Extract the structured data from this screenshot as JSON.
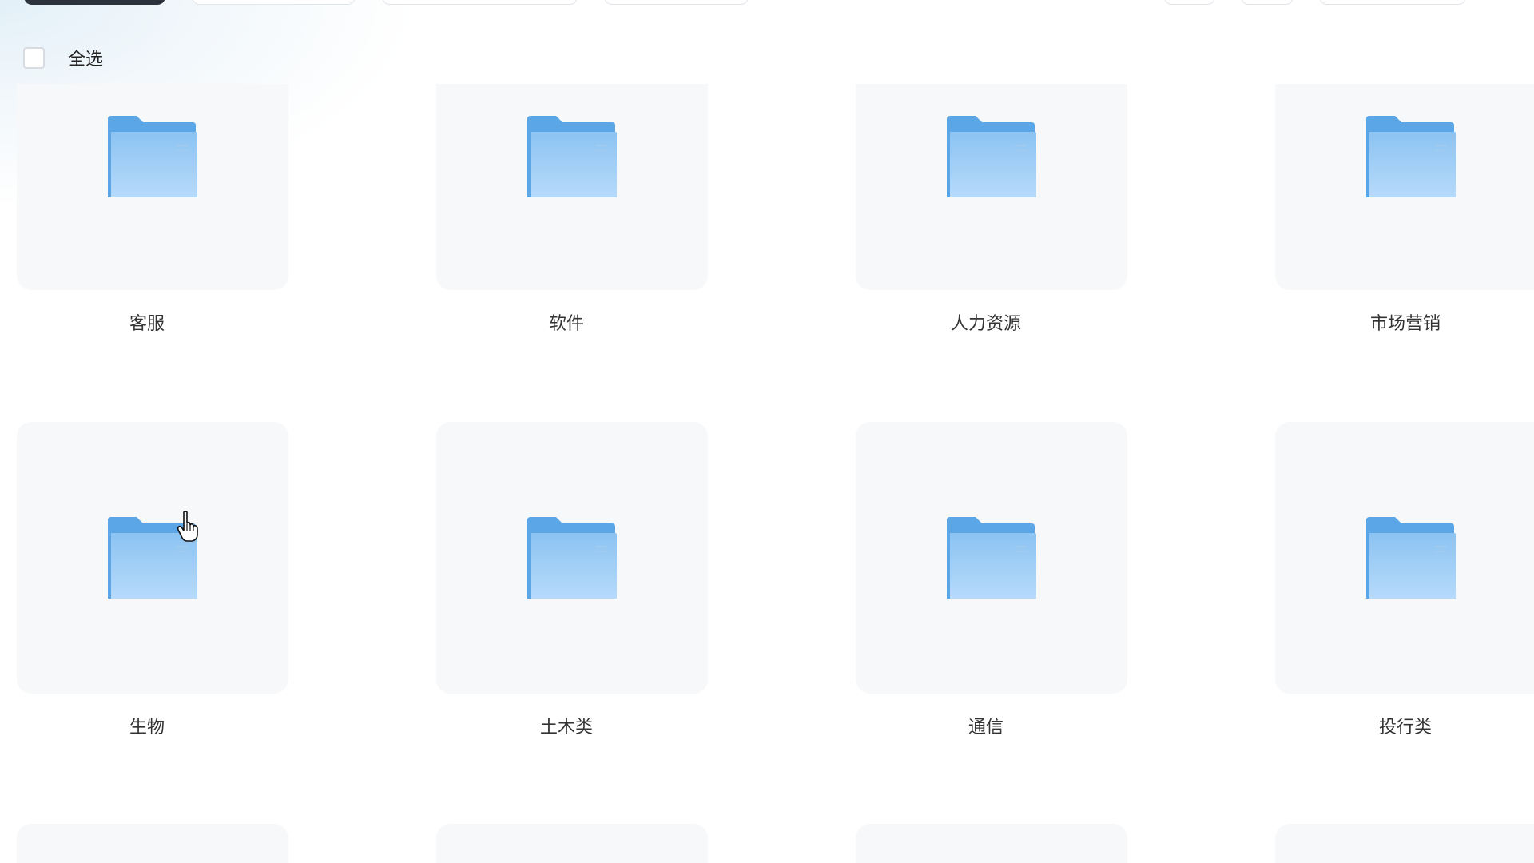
{
  "select_all": {
    "label": "全选"
  },
  "folders_row1": [
    {
      "name": "客服"
    },
    {
      "name": "软件"
    },
    {
      "name": "人力资源"
    },
    {
      "name": "市场营销"
    }
  ],
  "folders_row2": [
    {
      "name": "生物"
    },
    {
      "name": "土木类"
    },
    {
      "name": "通信"
    },
    {
      "name": "投行类"
    }
  ],
  "colors": {
    "folder_back": "#5aa6e6",
    "folder_front_top": "#8cc3f2",
    "folder_front_bottom": "#b6dafa",
    "card_bg": "#f7f8f9",
    "primary_button": "#2b323c"
  },
  "icons": {
    "folder": "folder-icon",
    "cursor": "hand-pointer-icon"
  }
}
